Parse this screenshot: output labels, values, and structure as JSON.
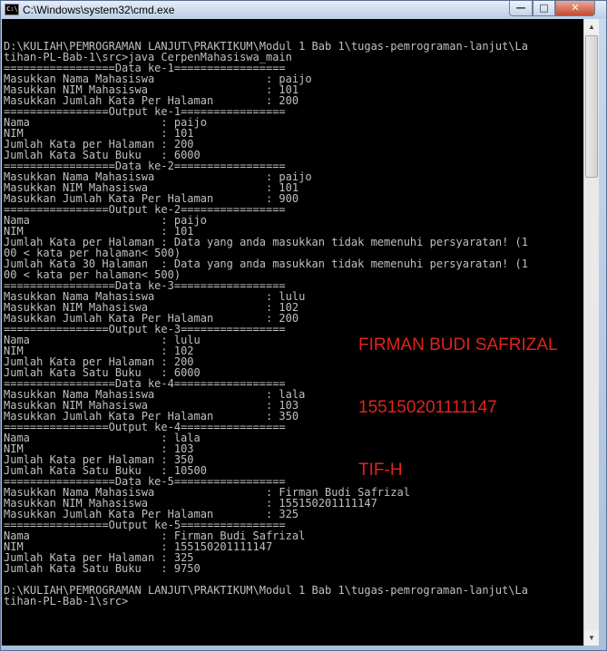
{
  "window": {
    "title": "C:\\Windows\\system32\\cmd.exe",
    "icon": "cmd-icon",
    "controls": {
      "minimize": "—",
      "maximize": "□",
      "close": "✕"
    }
  },
  "console": {
    "lines": [
      "",
      "D:\\KULIAH\\PEMROGRAMAN LANJUT\\PRAKTIKUM\\Modul 1 Bab 1\\tugas-pemrograman-lanjut\\La",
      "tihan-PL-Bab-1\\src>java CerpenMahasiswa_main",
      "=================Data ke-1=================",
      "Masukkan Nama Mahasiswa                 : paijo",
      "Masukkan NIM Mahasiswa                  : 101",
      "Masukkan Jumlah Kata Per Halaman        : 200",
      "================Output ke-1================",
      "Nama                    : paijo",
      "NIM                     : 101",
      "Jumlah Kata per Halaman : 200",
      "Jumlah Kata Satu Buku   : 6000",
      "=================Data ke-2=================",
      "Masukkan Nama Mahasiswa                 : paijo",
      "Masukkan NIM Mahasiswa                  : 101",
      "Masukkan Jumlah Kata Per Halaman        : 900",
      "================Output ke-2================",
      "Nama                    : paijo",
      "NIM                     : 101",
      "Jumlah Kata per Halaman : Data yang anda masukkan tidak memenuhi persyaratan! (1",
      "00 < kata per halaman< 500)",
      "Jumlah Kata 30 Halaman  : Data yang anda masukkan tidak memenuhi persyaratan! (1",
      "00 < kata per halaman< 500)",
      "=================Data ke-3=================",
      "Masukkan Nama Mahasiswa                 : lulu",
      "Masukkan NIM Mahasiswa                  : 102",
      "Masukkan Jumlah Kata Per Halaman        : 200",
      "================Output ke-3================",
      "Nama                    : lulu",
      "NIM                     : 102",
      "Jumlah Kata per Halaman : 200",
      "Jumlah Kata Satu Buku   : 6000",
      "=================Data ke-4=================",
      "Masukkan Nama Mahasiswa                 : lala",
      "Masukkan NIM Mahasiswa                  : 103",
      "Masukkan Jumlah Kata Per Halaman        : 350",
      "================Output ke-4================",
      "Nama                    : lala",
      "NIM                     : 103",
      "Jumlah Kata per Halaman : 350",
      "Jumlah Kata Satu Buku   : 10500",
      "=================Data ke-5=================",
      "Masukkan Nama Mahasiswa                 : Firman Budi Safrizal",
      "Masukkan NIM Mahasiswa                  : 155150201111147",
      "Masukkan Jumlah Kata Per Halaman        : 325",
      "================Output ke-5================",
      "Nama                    : Firman Budi Safrizal",
      "NIM                     : 155150201111147",
      "Jumlah Kata per Halaman : 325",
      "Jumlah Kata Satu Buku   : 9750",
      "",
      "D:\\KULIAH\\PEMROGRAMAN LANJUT\\PRAKTIKUM\\Modul 1 Bab 1\\tugas-pemrograman-lanjut\\La",
      "tihan-PL-Bab-1\\src>"
    ]
  },
  "annotation": {
    "lines": [
      "FIRMAN BUDI SAFRIZAL",
      "155150201111147",
      "TIF-H"
    ],
    "color": "#e2231a"
  },
  "scrollbar": {
    "up": "▲",
    "down": "▼"
  }
}
